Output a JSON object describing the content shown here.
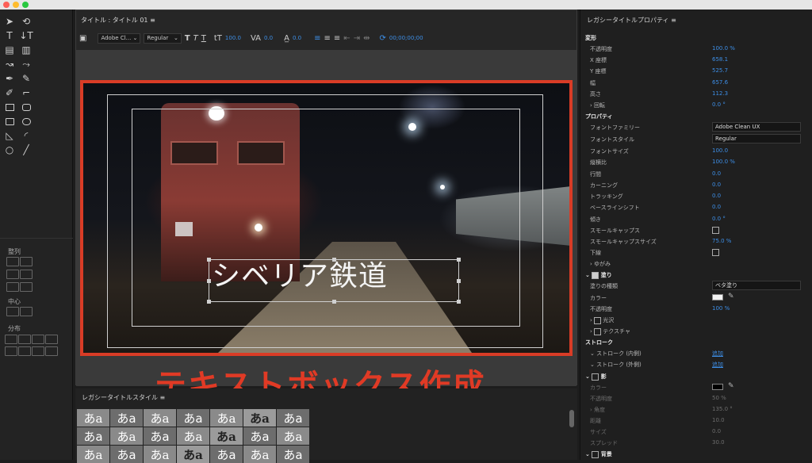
{
  "main": {
    "tab_title": "タイトル : タイトル 01",
    "font_family": "Adobe Cl...",
    "font_style": "Regular",
    "font_size": "100.0",
    "kerning": "0.0",
    "baseline": "0.0",
    "timecode": "00;00;00;00",
    "title_text": "シベリア鉄道",
    "overlay_caption": "テキストボックス作成"
  },
  "tools": {
    "align_header": "整列",
    "center_header": "中心",
    "distribute_header": "分布"
  },
  "styles": {
    "header": "レガシータイトルスタイル",
    "sample_char": "あa",
    "row_count": 3
  },
  "properties": {
    "header": "レガシータイトルプロパティ",
    "transform": {
      "label": "変形",
      "opacity_label": "不透明度",
      "opacity": "100.0 %",
      "x_label": "X 座標",
      "x": "658.1",
      "y_label": "Y 座標",
      "y": "525.7",
      "width_label": "幅",
      "width": "657.6",
      "height_label": "高さ",
      "height": "112.3",
      "rotation_label": "回転",
      "rotation": "0.0 °"
    },
    "prop": {
      "label": "プロパティ",
      "family_label": "フォントファミリー",
      "family": "Adobe Clean UX",
      "style_label": "フォントスタイル",
      "style": "Regular",
      "size_label": "フォントサイズ",
      "size": "100.0",
      "aspect_label": "縦横比",
      "aspect": "100.0 %",
      "leading_label": "行間",
      "leading": "0.0",
      "kerning_label": "カーニング",
      "kerning": "0.0",
      "tracking_label": "トラッキング",
      "tracking": "0.0",
      "baseline_label": "ベースラインシフト",
      "baseline": "0.0",
      "slant_label": "傾き",
      "slant": "0.0 °",
      "smallcaps_label": "スモールキャップス",
      "smallcaps_size_label": "スモールキャップスサイズ",
      "smallcaps_size": "75.0 %",
      "underline_label": "下線",
      "distort_label": "ゆがみ"
    },
    "fill": {
      "label": "塗り",
      "type_label": "塗りの種類",
      "type": "ベタ塗り",
      "color_label": "カラー",
      "color": "#f2f2f2",
      "opacity_label": "不透明度",
      "opacity": "100 %",
      "sheen_label": "光沢",
      "texture_label": "テクスチャ"
    },
    "stroke": {
      "label": "ストローク",
      "inner_label": "ストローク (内側)",
      "inner_action": "追加",
      "outer_label": "ストローク (外側)",
      "outer_action": "追加"
    },
    "shadow": {
      "label": "影",
      "color_label": "カラー",
      "color": "#000000",
      "opacity_label": "不透明度",
      "opacity": "50 %",
      "angle_label": "角度",
      "angle": "135.0 °",
      "distance_label": "距離",
      "distance": "10.0",
      "size_label": "サイズ",
      "size": "0.0",
      "spread_label": "スプレッド",
      "spread": "30.0"
    },
    "background": {
      "label": "背景"
    }
  }
}
